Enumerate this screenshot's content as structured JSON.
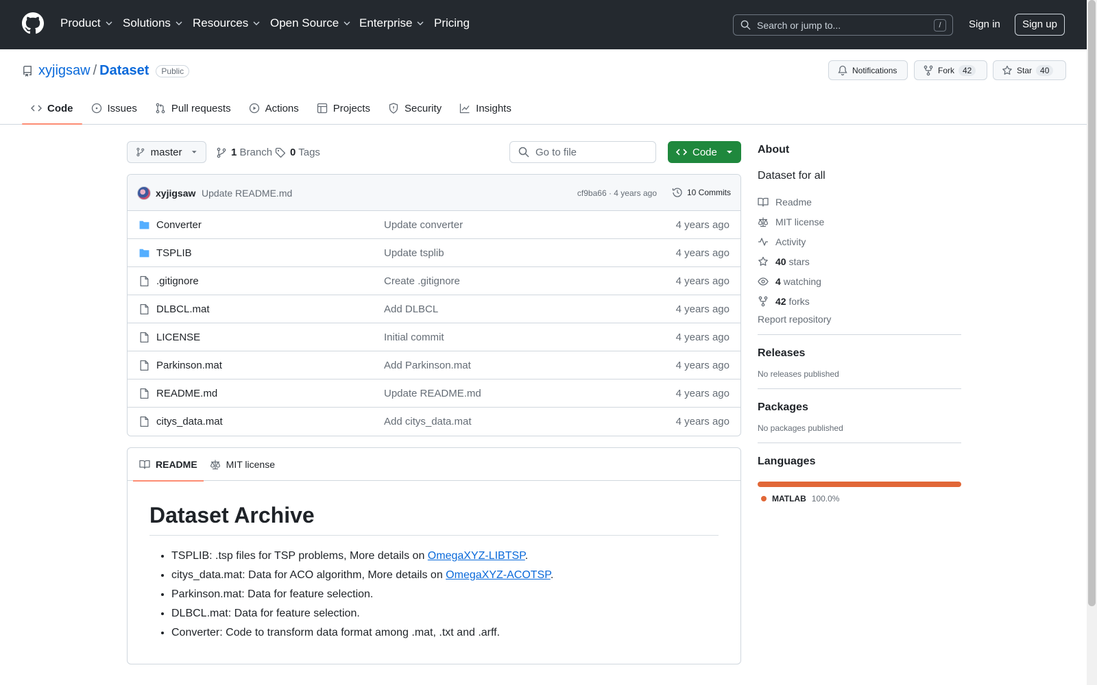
{
  "header": {
    "nav": [
      {
        "label": "Product",
        "dropdown": true
      },
      {
        "label": "Solutions",
        "dropdown": true
      },
      {
        "label": "Resources",
        "dropdown": true
      },
      {
        "label": "Open Source",
        "dropdown": true
      },
      {
        "label": "Enterprise",
        "dropdown": true
      },
      {
        "label": "Pricing",
        "dropdown": false
      }
    ],
    "search_placeholder": "Search or jump to...",
    "search_shortcut": "/",
    "sign_in": "Sign in",
    "sign_up": "Sign up"
  },
  "repo": {
    "owner": "xyjigsaw",
    "separator": "/",
    "name": "Dataset",
    "visibility": "Public",
    "notifications_label": "Notifications",
    "fork_label": "Fork",
    "fork_count": "42",
    "star_label": "Star",
    "star_count": "40"
  },
  "tabs": [
    "Code",
    "Issues",
    "Pull requests",
    "Actions",
    "Projects",
    "Security",
    "Insights"
  ],
  "toolbar": {
    "branch": "master",
    "branch_count": "1",
    "branch_word": "Branch",
    "tag_count": "0",
    "tag_word": "Tags",
    "go_to_file": "Go to file",
    "code_button": "Code"
  },
  "commit": {
    "author": "xyjigsaw",
    "message": "Update README.md",
    "hash_age": "cf9ba66 · 4 years ago",
    "commits": "10 Commits"
  },
  "files": [
    {
      "name": "Converter",
      "type": "dir",
      "message": "Update converter",
      "age": "4 years ago"
    },
    {
      "name": "TSPLIB",
      "type": "dir",
      "message": "Update tsplib",
      "age": "4 years ago"
    },
    {
      "name": ".gitignore",
      "type": "file",
      "message": "Create .gitignore",
      "age": "4 years ago"
    },
    {
      "name": "DLBCL.mat",
      "type": "file",
      "message": "Add DLBCL",
      "age": "4 years ago"
    },
    {
      "name": "LICENSE",
      "type": "file",
      "message": "Initial commit",
      "age": "4 years ago"
    },
    {
      "name": "Parkinson.mat",
      "type": "file",
      "message": "Add Parkinson.mat",
      "age": "4 years ago"
    },
    {
      "name": "README.md",
      "type": "file",
      "message": "Update README.md",
      "age": "4 years ago"
    },
    {
      "name": "citys_data.mat",
      "type": "file",
      "message": "Add citys_data.mat",
      "age": "4 years ago"
    }
  ],
  "readme": {
    "tab_readme": "README",
    "tab_license": "MIT license",
    "title": "Dataset Archive",
    "items": [
      {
        "text": "TSPLIB: .tsp files for TSP problems, More details on ",
        "link": "OmegaXYZ-LIBTSP",
        "after": "."
      },
      {
        "text": "citys_data.mat: Data for ACO algorithm, More details on ",
        "link": "OmegaXYZ-ACOTSP",
        "after": "."
      },
      {
        "text": "Parkinson.mat: Data for feature selection.",
        "link": "",
        "after": ""
      },
      {
        "text": "DLBCL.mat: Data for feature selection.",
        "link": "",
        "after": ""
      },
      {
        "text": "Converter: Code to transform data format among .mat, .txt and .arff.",
        "link": "",
        "after": ""
      }
    ]
  },
  "sidebar": {
    "about_title": "About",
    "description": "Dataset for all",
    "links": {
      "readme": "Readme",
      "license": "MIT license",
      "activity": "Activity",
      "stars_count": "40",
      "stars_word": "stars",
      "watching_count": "4",
      "watching_word": "watching",
      "forks_count": "42",
      "forks_word": "forks"
    },
    "report": "Report repository",
    "releases_title": "Releases",
    "releases_note": "No releases published",
    "packages_title": "Packages",
    "packages_note": "No packages published",
    "languages_title": "Languages",
    "languages": [
      {
        "name": "MATLAB",
        "percent": "100.0%",
        "color": "#e16737"
      }
    ]
  },
  "colors": {
    "accent": "#0969da",
    "header_bg": "#24292f",
    "code_button": "#1f883d",
    "tab_underline": "#fd8c73"
  }
}
